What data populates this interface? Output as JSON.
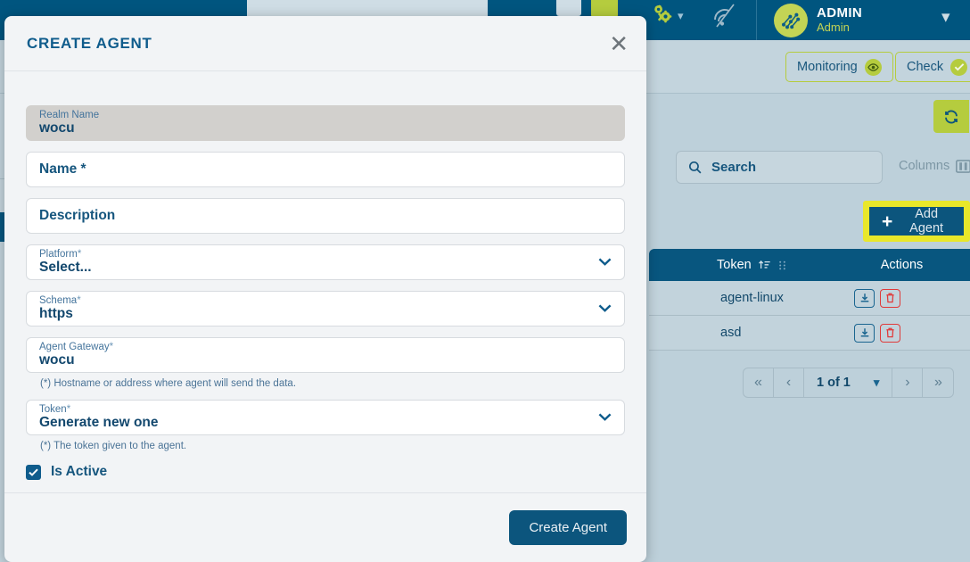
{
  "topbar": {
    "user_name": "ADMIN",
    "user_role": "Admin",
    "gear_icon": "gears-icon",
    "caret_icon": "chevron-down-icon",
    "nosignal_icon": "no-signal-icon",
    "avatar_icon": "network-avatar-icon",
    "user_caret_icon": "chevron-down-icon"
  },
  "subheader": {
    "monitoring_label": "Monitoring",
    "monitoring_icon": "eye-icon",
    "check_label": "Check",
    "check_icon": "check-circle-icon"
  },
  "toolbar": {
    "refresh_icon": "refresh-icon",
    "search_placeholder": "Search",
    "search_icon": "search-icon",
    "columns_label": "Columns",
    "columns_icon": "columns-icon",
    "add_agent_label": "Add Agent",
    "add_agent_plus": "+"
  },
  "table": {
    "columns": [
      {
        "label": "Token",
        "sort_icon": "sort-asc-icon",
        "grip_icon": "drag-grip-icon"
      },
      {
        "label": "Actions"
      }
    ],
    "rows": [
      {
        "token": "agent-linux",
        "download_icon": "download-icon",
        "delete_icon": "trash-icon"
      },
      {
        "token": "asd",
        "download_icon": "download-icon",
        "delete_icon": "trash-icon"
      }
    ]
  },
  "pagination": {
    "first_icon": "«",
    "prev_icon": "‹",
    "label": "1 of 1",
    "caret_icon": "chevron-down-icon",
    "next_icon": "›",
    "last_icon": "»"
  },
  "modal": {
    "title": "CREATE AGENT",
    "close_icon": "close-icon",
    "submit_label": "Create Agent",
    "fields": {
      "realm": {
        "label": "Realm Name",
        "value": "wocu"
      },
      "name": {
        "label": "Name",
        "required": "*",
        "placeholder": "Name *"
      },
      "description": {
        "placeholder": "Description"
      },
      "platform": {
        "label": "Platform",
        "required": "*",
        "value": "Select...",
        "chevron_icon": "chevron-down-icon"
      },
      "schema": {
        "label": "Schema",
        "required": "*",
        "value": "https",
        "chevron_icon": "chevron-down-icon"
      },
      "gateway": {
        "label": "Agent Gateway",
        "required": "*",
        "value": "wocu",
        "helper": "(*) Hostname or address where agent will send the data."
      },
      "token": {
        "label": "Token",
        "required": "*",
        "value": "Generate new one",
        "chevron_icon": "chevron-down-icon",
        "helper": "(*) The token given to the agent."
      },
      "is_active": {
        "label": "Is Active",
        "checked_icon": "check-icon"
      }
    }
  },
  "colors": {
    "brand_blue": "#00557f",
    "accent_green": "#b5cc3e",
    "highlight_yellow": "#e9e72a",
    "danger_red": "#e03a3a",
    "page_bg": "#bdd0da"
  }
}
